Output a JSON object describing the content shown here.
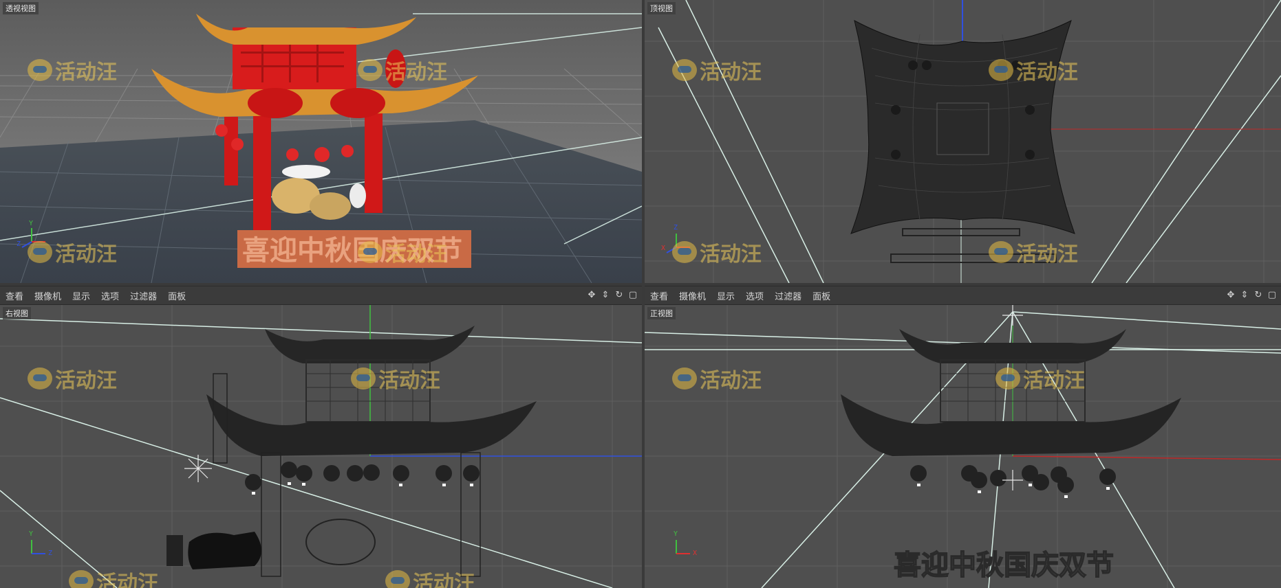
{
  "viewports": {
    "perspective": {
      "label": "透视视图"
    },
    "top": {
      "label": "顶视图"
    },
    "right": {
      "label": "右视图"
    },
    "front": {
      "label": "正视图"
    }
  },
  "menu": {
    "view": "查看",
    "camera": "摄像机",
    "display": "显示",
    "options": "选项",
    "filter": "过滤器",
    "panel": "面板"
  },
  "tool_icons": [
    "move-view-icon",
    "pan-view-icon",
    "rotate-view-icon",
    "maximize-view-icon"
  ],
  "axes": {
    "x": "X",
    "y": "Y",
    "z": "Z"
  },
  "model_text": "喜迎中秋国庆双节",
  "watermark": "活动汪",
  "colors": {
    "viewport_bg": "#4f4f4f",
    "grid": "#5f5f5f",
    "menubar_bg": "#3b3b3b",
    "pavilion_red": "#d01818",
    "roof_orange": "#d9922f",
    "wire": "#1f1f1f",
    "axis_x": "#e03030",
    "axis_y": "#40c040",
    "axis_z": "#3050e0"
  }
}
